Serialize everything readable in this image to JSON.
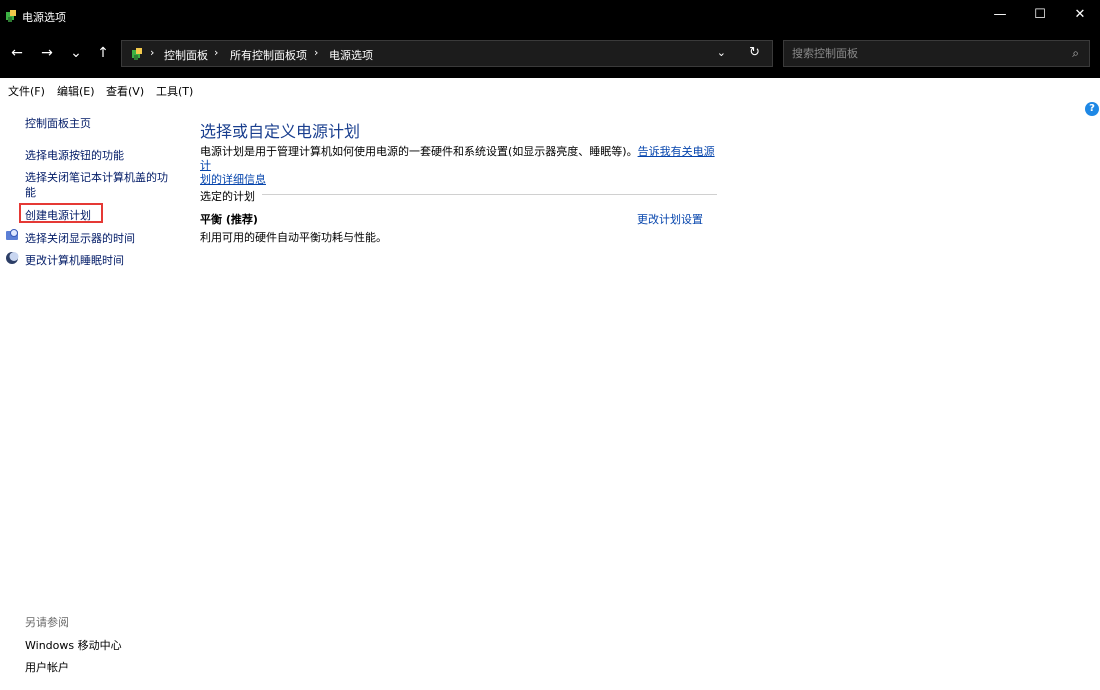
{
  "window": {
    "title": "电源选项",
    "minimize_glyph": "—",
    "maximize_glyph": "☐",
    "close_glyph": "✕"
  },
  "nav": {
    "back": "←",
    "forward": "→",
    "recent": "⌄",
    "up": "↑"
  },
  "address": {
    "segments": [
      "控制面板",
      "所有控制面板项",
      "电源选项"
    ],
    "separator": "›",
    "dropdown": "⌄",
    "refresh": "↻"
  },
  "search": {
    "placeholder": "搜索控制面板",
    "icon": "⌕"
  },
  "menu": [
    "文件(F)",
    "编辑(E)",
    "查看(V)",
    "工具(T)"
  ],
  "sidebar": {
    "home": "控制面板主页",
    "items": [
      "选择电源按钮的功能",
      "选择关闭笔记本计算机盖的功",
      "能",
      "创建电源计划",
      "选择关闭显示器的时间",
      "更改计算机睡眠时间"
    ]
  },
  "main": {
    "title": "选择或自定义电源计划",
    "description": "电源计划是用于管理计算机如何使用电源的一套硬件和系统设置(如显示器亮度、睡眠等)。",
    "learn_more_1": "告诉我有关电源计",
    "learn_more_2": "划的详细信息",
    "group_label": "选定的计划",
    "plan": {
      "name": "平衡 (推荐)",
      "description": "利用可用的硬件自动平衡功耗与性能。",
      "change_link": "更改计划设置"
    }
  },
  "see_also": {
    "label": "另请参阅",
    "links": [
      "Windows 移动中心",
      "用户帐户"
    ]
  },
  "help_icon": "?",
  "colors": {
    "titlebar": "#000000",
    "link": "#0645ad",
    "heading": "#1a3f8f",
    "highlight": "#e53935"
  }
}
